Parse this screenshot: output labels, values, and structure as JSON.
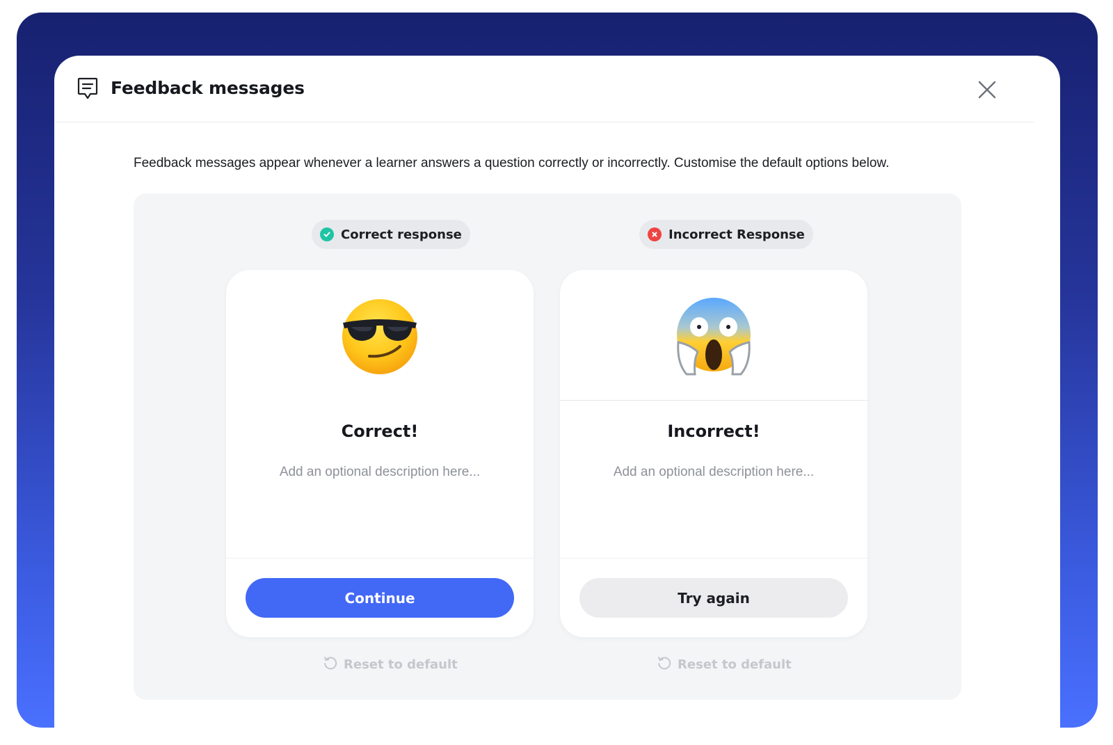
{
  "header": {
    "title": "Feedback messages",
    "icon": "message-square-icon",
    "close_icon": "close-icon"
  },
  "intro_text": "Feedback messages appear whenever a learner answers a question correctly or incorrectly. Customise the default options below.",
  "correct": {
    "pill_label": "Correct response",
    "pill_color": "#20c4a4",
    "emoji": "smiling-face-with-sunglasses",
    "title": "Correct!",
    "description_placeholder": "Add an optional description here...",
    "button_label": "Continue",
    "button_color": "#4268f6",
    "reset_label": "Reset to default"
  },
  "incorrect": {
    "pill_label": "Incorrect Response",
    "pill_color": "#ee4444",
    "emoji": "face-screaming-in-fear",
    "title": "Incorrect!",
    "description_placeholder": "Add an optional description here...",
    "button_label": "Try again",
    "reset_label": "Reset to default"
  },
  "colors": {
    "frame_top": "#172170",
    "frame_bottom": "#4a70ff",
    "panel_bg": "#f4f5f7"
  }
}
